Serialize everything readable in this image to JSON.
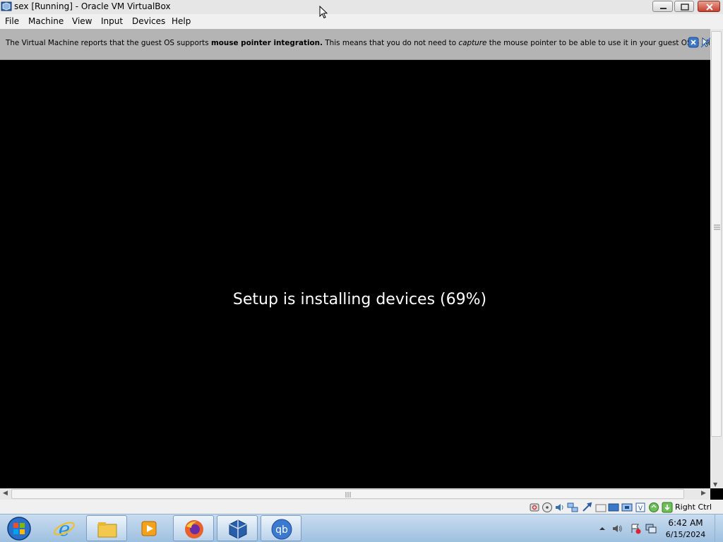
{
  "window": {
    "title": "sex [Running] - Oracle VM VirtualBox",
    "icon": "virtualbox-icon"
  },
  "menu": {
    "items": [
      {
        "label": "File"
      },
      {
        "label": "Machine"
      },
      {
        "label": "View"
      },
      {
        "label": "Input"
      },
      {
        "label": "Devices"
      },
      {
        "label": "Help"
      }
    ]
  },
  "notification": {
    "text_1": "The Virtual Machine reports that the guest OS supports ",
    "bold": "mouse pointer integration.",
    "text_2": " This means that you do not need to ",
    "italic": "capture",
    "text_3": " the mouse pointer to be able to use it in your guest OS -- all mouse"
  },
  "guest": {
    "message": "Setup is installing devices (69%)"
  },
  "statusbar": {
    "host_key": "Right Ctrl",
    "icons": [
      "hard-disk-icon",
      "optical-drive-icon",
      "audio-icon",
      "network-icon",
      "usb-icon",
      "shared-folders-icon",
      "display-icon",
      "video-capture-icon",
      "virtualization-icon",
      "mouse-integration-icon",
      "keyboard-icon"
    ]
  },
  "taskbar": {
    "apps": [
      "internet-explorer-icon",
      "file-explorer-icon",
      "media-player-icon",
      "firefox-icon",
      "virtualbox-icon",
      "qbittorrent-icon"
    ],
    "clock_time": "6:42 AM",
    "clock_date": "6/15/2024"
  },
  "colors": {
    "accent": "#1e6fc0",
    "firefox": "#e8602c",
    "qbittorrent": "#3b7ad0",
    "close_button": "#c84030"
  }
}
